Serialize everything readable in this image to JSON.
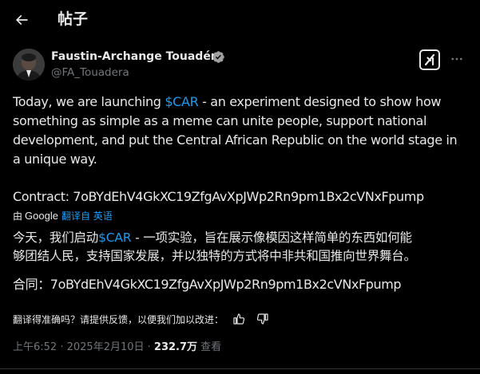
{
  "header": {
    "title": "帖子"
  },
  "author": {
    "name": "Faustin-Archange Touadéra",
    "handle": "@FA_Touadera"
  },
  "tweet": {
    "line1_pre": "Today, we are launching ",
    "cashtag": "$CAR",
    "line1_post": " - an experiment designed to show how",
    "line2": "something as simple as a meme can unite people, support national",
    "line3": "development, and put the Central African Republic on the world stage in",
    "line4": "a unique way.",
    "contract": "Contract: 7oBYdEhV4GkXC19ZfgAvXpJWp2Rn9pm1Bx2cVNxFpump"
  },
  "translation": {
    "by_label": "由",
    "google": "Google",
    "translated_from": "翻译自 英语",
    "line1_pre": "今天，我们启动",
    "cashtag": "$CAR",
    "line1_post": " - 一项实验，旨在展示像模因这样简单的东西如何能",
    "line2": "够团结人民，支持国家发展，并以独特的方式将中非共和国推向世界舞台。",
    "contract": "合同：7oBYdEhV4GkXC19ZfgAvXpJWp2Rn9pm1Bx2cVNxFpump",
    "feedback_prompt": "翻译得准确吗？请提供反馈，以便我们加以改进："
  },
  "meta": {
    "time": "上午6:52",
    "sep1": " · ",
    "date": "2025年2月10日",
    "sep2": " · ",
    "views": "232.7万",
    "views_label": " 查看"
  },
  "icons": {
    "back": "arrow-left-icon",
    "verified": "verified-badge-icon",
    "grok": "grok-icon",
    "more": "more-horizontal-icon",
    "thumbs_up": "thumbs-up-icon",
    "thumbs_down": "thumbs-down-icon"
  },
  "colors": {
    "background": "#000000",
    "text": "#e7e9ea",
    "secondary": "#71767b",
    "accent": "#1d9bf0"
  }
}
